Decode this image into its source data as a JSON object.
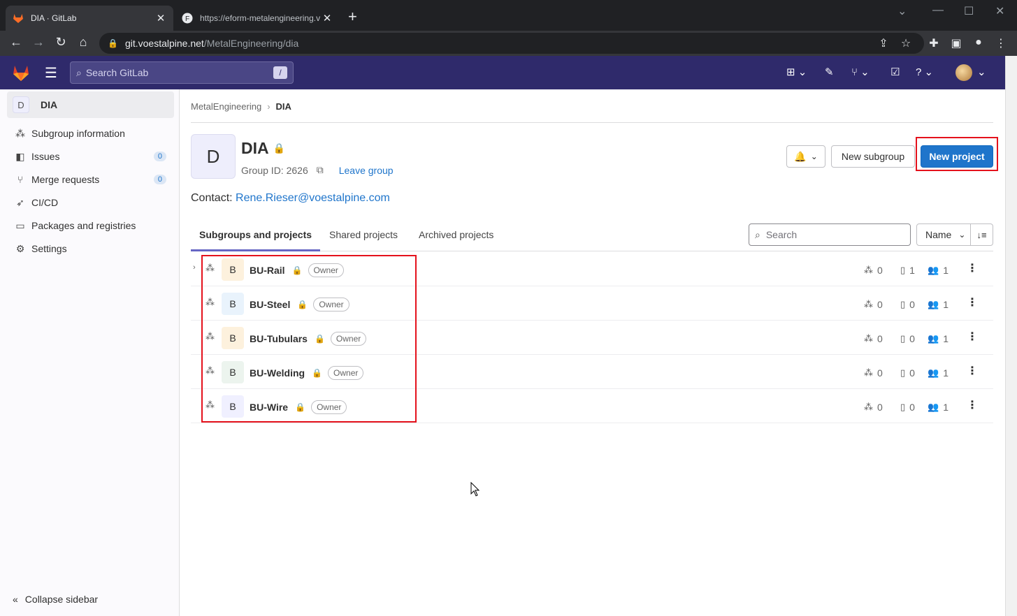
{
  "browser": {
    "tabs": [
      {
        "title": "DIA · GitLab",
        "active": true
      },
      {
        "title": "https://eform-metalengineering.v",
        "active": false
      }
    ],
    "url_host": "git.voestalpine.net",
    "url_path": "/MetalEngineering/dia"
  },
  "header": {
    "search_placeholder": "Search GitLab",
    "search_shortcut": "/"
  },
  "sidebar": {
    "group_avatar": "D",
    "group_name": "DIA",
    "items": [
      {
        "label": "Subgroup information",
        "icon": "hierarchy-icon"
      },
      {
        "label": "Issues",
        "icon": "issues-icon",
        "count": "0"
      },
      {
        "label": "Merge requests",
        "icon": "merge-request-icon",
        "count": "0"
      },
      {
        "label": "CI/CD",
        "icon": "rocket-icon"
      },
      {
        "label": "Packages and registries",
        "icon": "package-icon"
      },
      {
        "label": "Settings",
        "icon": "gear-icon"
      }
    ],
    "collapse_label": "Collapse sidebar"
  },
  "breadcrumb": {
    "parent": "MetalEngineering",
    "current": "DIA"
  },
  "group": {
    "avatar": "D",
    "name": "DIA",
    "id_label": "Group ID: 2626",
    "leave_label": "Leave group",
    "contact_label": "Contact:",
    "contact_email": "Rene.Rieser@voestalpine.com"
  },
  "actions": {
    "new_subgroup": "New subgroup",
    "new_project": "New project"
  },
  "tabs": [
    {
      "label": "Subgroups and projects",
      "active": true
    },
    {
      "label": "Shared projects"
    },
    {
      "label": "Archived projects"
    }
  ],
  "filter": {
    "placeholder": "Search",
    "sort_label": "Name"
  },
  "subgroups": [
    {
      "avatar": "B",
      "name": "BU-Rail",
      "role": "Owner",
      "subgroups": "0",
      "projects": "1",
      "members": "1",
      "avatar_color": "#fdf1dd",
      "expandable": true
    },
    {
      "avatar": "B",
      "name": "BU-Steel",
      "role": "Owner",
      "subgroups": "0",
      "projects": "0",
      "members": "1",
      "avatar_color": "#e9f3fc"
    },
    {
      "avatar": "B",
      "name": "BU-Tubulars",
      "role": "Owner",
      "subgroups": "0",
      "projects": "0",
      "members": "1",
      "avatar_color": "#fdf1dd"
    },
    {
      "avatar": "B",
      "name": "BU-Welding",
      "role": "Owner",
      "subgroups": "0",
      "projects": "0",
      "members": "1",
      "avatar_color": "#ecf4ee"
    },
    {
      "avatar": "B",
      "name": "BU-Wire",
      "role": "Owner",
      "subgroups": "0",
      "projects": "0",
      "members": "1",
      "avatar_color": "#f0f0ff"
    }
  ],
  "colors": {
    "header_bg": "#2f2a6b",
    "primary": "#1f75cb",
    "highlight": "#e4121c"
  }
}
